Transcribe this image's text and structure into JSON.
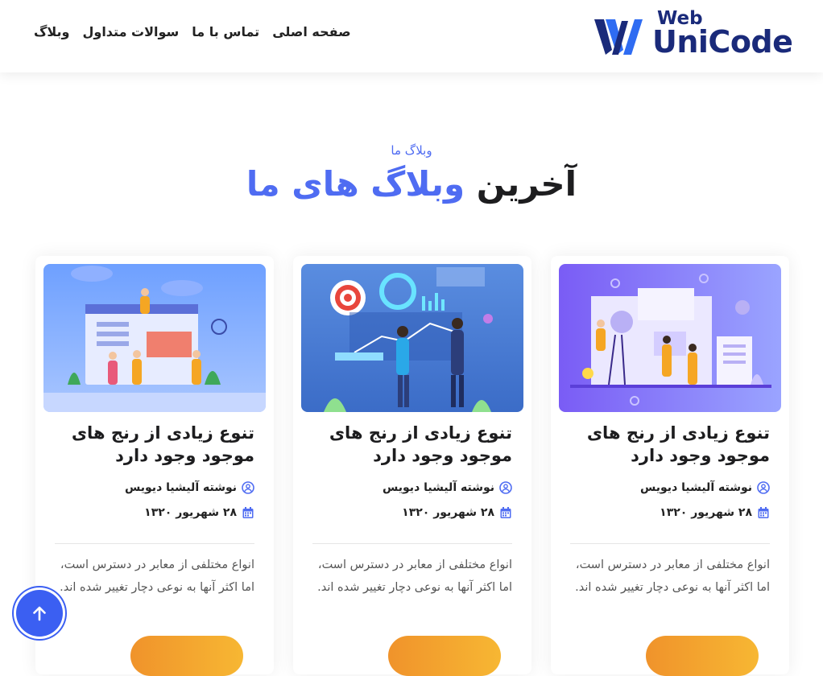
{
  "brand": {
    "logo_top": "Web",
    "logo_main": "UniCode",
    "color_dark": "#1a2a7a",
    "color_accent": "#2f6cf2"
  },
  "nav": {
    "items": [
      {
        "label": "صفحه اصلی"
      },
      {
        "label": "تماس با ما"
      },
      {
        "label": "سوالات متداول"
      },
      {
        "label": "وبلاگ"
      }
    ]
  },
  "section": {
    "kicker": "وبلاگ ما",
    "title_dark": "آخرین",
    "title_blue": "وبلاگ های ما"
  },
  "cards": [
    {
      "image": "team-analytics-illustration",
      "title": "تنوع زیادی از رنج های موجود وجود دارد",
      "author": "نوشته آلیشیا دیویس",
      "date": "۲۸ شهریور ۱۳۲۰",
      "excerpt": "انواع مختلفی از معابر در دسترس است، اما اکثر آنها به نوعی دچار تغییر شده اند."
    },
    {
      "image": "business-meeting-illustration",
      "title": "تنوع زیادی از رنج های موجود وجود دارد",
      "author": "نوشته آلیشیا دیویس",
      "date": "۲۸ شهریور ۱۳۲۰",
      "excerpt": "انواع مختلفی از معابر در دسترس است، اما اکثر آنها به نوعی دچار تغییر شده اند."
    },
    {
      "image": "website-building-illustration",
      "title": "تنوع زیادی از رنج های موجود وجود دارد",
      "author": "نوشته آلیشیا دیویس",
      "date": "۲۸ شهریور ۱۳۲۰",
      "excerpt": "انواع مختلفی از معابر در دسترس است، اما اکثر آنها به نوعی دچار تغییر شده اند."
    }
  ],
  "colors": {
    "accent_blue": "#4f6cf2",
    "button_gradient_start": "#f0932b",
    "button_gradient_end": "#f7b733",
    "icon_color": "#4f6cf2"
  },
  "icons": {
    "author": "user-circle-icon",
    "date": "calendar-icon",
    "back_to_top": "arrow-up-icon"
  }
}
